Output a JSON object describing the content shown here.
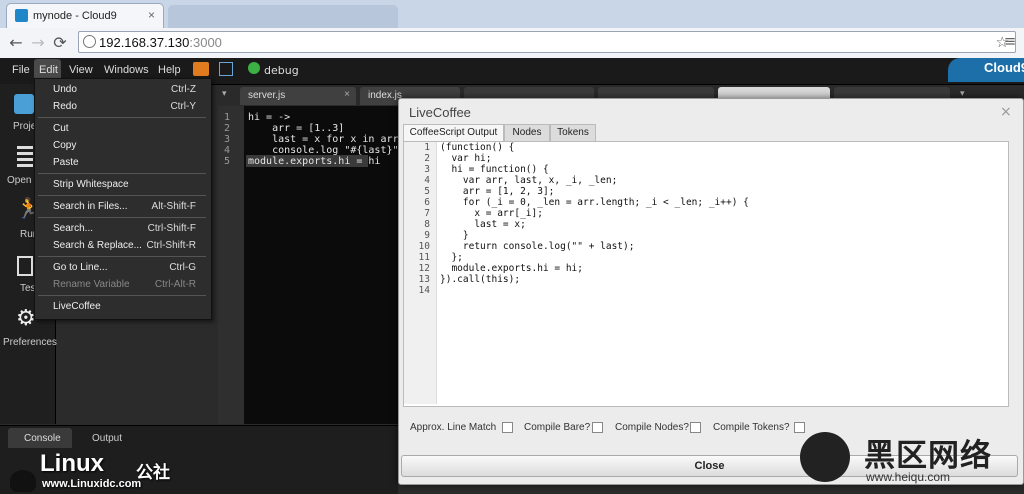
{
  "browser": {
    "tab_title": "mynode - Cloud9",
    "url_host": "192.168.37.130",
    "url_port": ":3000"
  },
  "menubar": {
    "items": [
      "File",
      "Edit",
      "View",
      "Windows",
      "Help"
    ],
    "run_config": "debug",
    "brand": "Cloud9"
  },
  "sidebar": {
    "items": [
      "Proje",
      "Open",
      "Run",
      "Test",
      "Preferences"
    ]
  },
  "editor": {
    "tabs": [
      "server.js",
      "index.js"
    ],
    "lines": [
      {
        "n": "1",
        "text": "hi = ->"
      },
      {
        "n": "2",
        "text": "    arr = [1..3]"
      },
      {
        "n": "3",
        "text": "    last = x for x in arr"
      },
      {
        "n": "4",
        "text": "    console.log \"#{last}\""
      },
      {
        "n": "5",
        "text": "module.exports.hi = hi"
      }
    ]
  },
  "edit_menu": {
    "items": [
      {
        "label": "Undo",
        "shortcut": "Ctrl-Z",
        "enabled": true
      },
      {
        "label": "Redo",
        "shortcut": "Ctrl-Y",
        "enabled": true
      },
      {
        "label": "Cut",
        "shortcut": "",
        "enabled": true
      },
      {
        "label": "Copy",
        "shortcut": "",
        "enabled": true
      },
      {
        "label": "Paste",
        "shortcut": "",
        "enabled": true
      },
      {
        "label": "Strip Whitespace",
        "shortcut": "",
        "enabled": true
      },
      {
        "label": "Search in Files...",
        "shortcut": "Alt-Shift-F",
        "enabled": true
      },
      {
        "label": "Search...",
        "shortcut": "Ctrl-Shift-F",
        "enabled": true
      },
      {
        "label": "Search & Replace...",
        "shortcut": "Ctrl-Shift-R",
        "enabled": true
      },
      {
        "label": "Go to Line...",
        "shortcut": "Ctrl-G",
        "enabled": true
      },
      {
        "label": "Rename Variable",
        "shortcut": "Ctrl-Alt-R",
        "enabled": false
      },
      {
        "label": "LiveCoffee",
        "shortcut": "",
        "enabled": true
      }
    ]
  },
  "console": {
    "tabs": [
      "Console",
      "Output"
    ]
  },
  "dialog": {
    "title": "LiveCoffee",
    "tabs": [
      "CoffeeScript Output",
      "Nodes",
      "Tokens"
    ],
    "code": [
      {
        "n": "1",
        "text": "(function() {"
      },
      {
        "n": "2",
        "text": "  var hi;"
      },
      {
        "n": "3",
        "text": "  hi = function() {"
      },
      {
        "n": "4",
        "text": "    var arr, last, x, _i, _len;"
      },
      {
        "n": "5",
        "text": "    arr = [1, 2, 3];"
      },
      {
        "n": "6",
        "text": "    for (_i = 0, _len = arr.length; _i < _len; _i++) {"
      },
      {
        "n": "7",
        "text": "      x = arr[_i];"
      },
      {
        "n": "8",
        "text": "      last = x;"
      },
      {
        "n": "9",
        "text": "    }"
      },
      {
        "n": "10",
        "text": "    return console.log(\"\" + last);"
      },
      {
        "n": "11",
        "text": "  };"
      },
      {
        "n": "12",
        "text": "  module.exports.hi = hi;"
      },
      {
        "n": "13",
        "text": "}).call(this);"
      },
      {
        "n": "14",
        "text": ""
      }
    ],
    "options": [
      "Approx. Line Match",
      "Compile Bare?",
      "Compile Nodes?",
      "Compile Tokens?"
    ],
    "close_label": "Close"
  },
  "watermarks": {
    "linux": "Linux",
    "linux_cn": "公社",
    "linux_url": "www.Linuxidc.com",
    "heiqu": "黑区网络",
    "heiqu_url": "www.heiqu.com"
  }
}
